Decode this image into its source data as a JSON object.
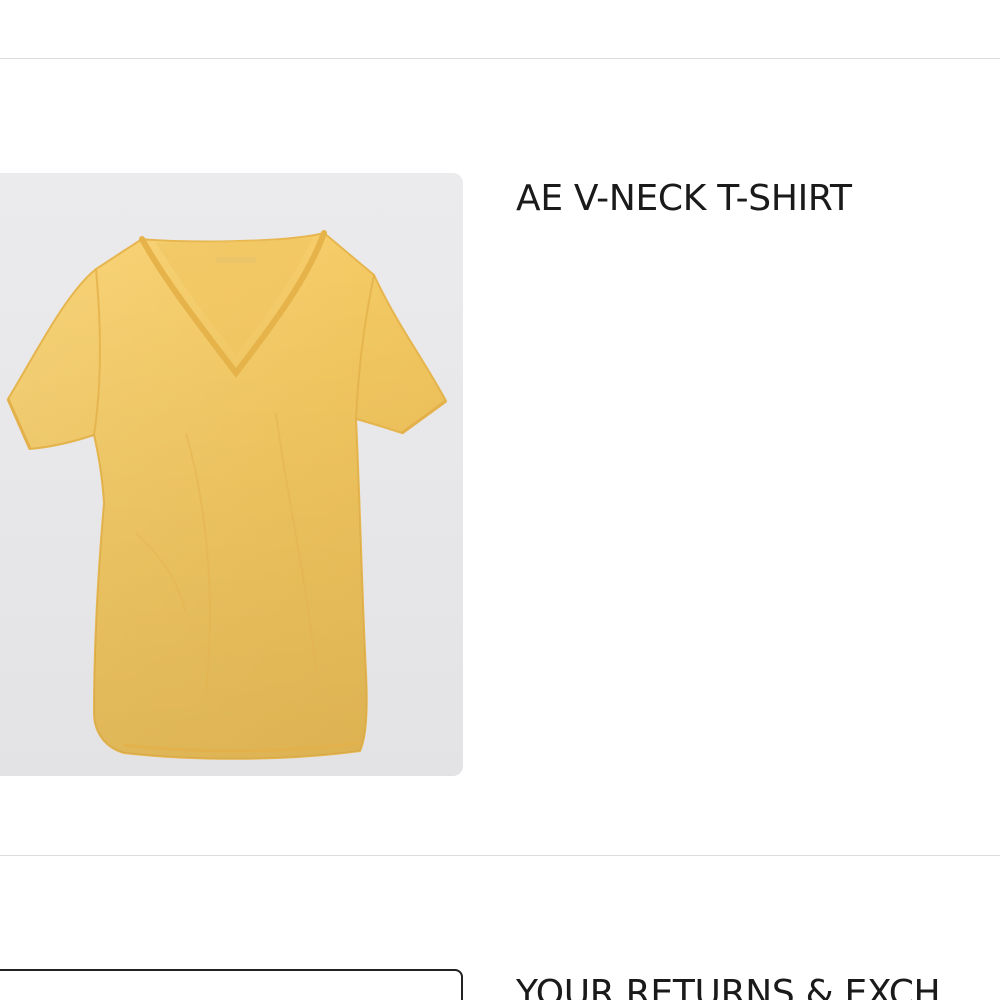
{
  "product": {
    "title": "AE V-NECK T-SHIRT",
    "image_alt": "Yellow v-neck t-shirt",
    "shirt_color": "#f5cd6e",
    "image_background": "#e8e8ea"
  },
  "next_section": {
    "title": "YOUR RETURNS & EXCH"
  },
  "colors": {
    "divider": "#dcdcdc",
    "text": "#1a1a1a",
    "page_background": "#ffffff"
  }
}
